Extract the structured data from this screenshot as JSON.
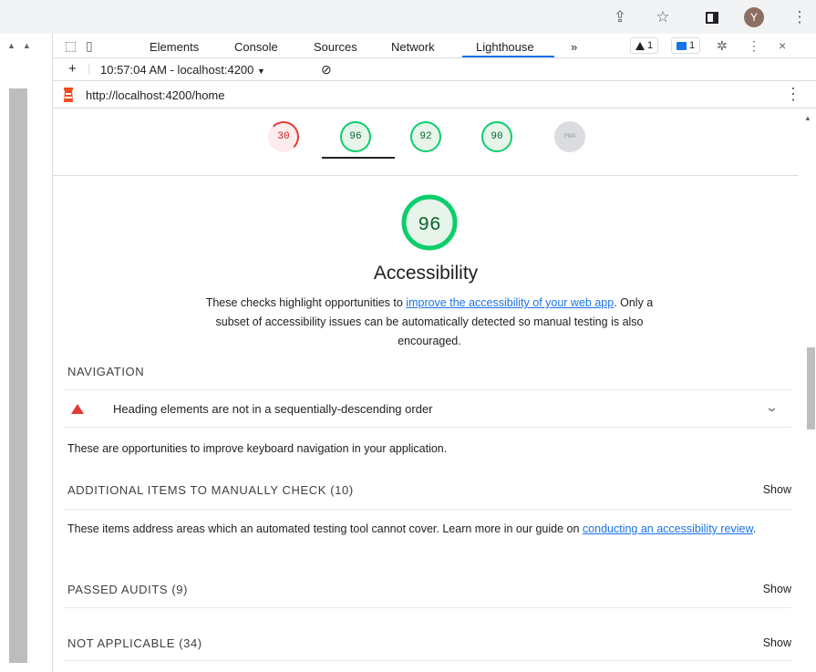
{
  "browser": {
    "avatar_letter": "Y",
    "icons": [
      "share-icon",
      "star-icon",
      "side-panel-icon",
      "more-vert-icon"
    ]
  },
  "devtools": {
    "tabs": [
      "Elements",
      "Console",
      "Sources",
      "Network",
      "Lighthouse"
    ],
    "more_tabs": "»",
    "warning_count": "1",
    "message_count": "1",
    "close": "×"
  },
  "report": {
    "selector": "10:57:04 AM - localhost:4200",
    "add": "+",
    "url": "http://localhost:4200/home"
  },
  "scores": [
    {
      "value": "30",
      "status": "fail"
    },
    {
      "value": "96",
      "status": "pass"
    },
    {
      "value": "92",
      "status": "pass"
    },
    {
      "value": "90",
      "status": "pass"
    },
    {
      "value": "PWA",
      "status": "na"
    }
  ],
  "category": {
    "score": "96",
    "title": "Accessibility",
    "desc_before": "These checks highlight opportunities to ",
    "desc_link": "improve the accessibility of your web app",
    "desc_after": ". Only a subset of accessibility issues can be automatically detected so manual testing is also encouraged."
  },
  "sections": {
    "navigation": "NAVIGATION",
    "audit_heading_order": "Heading elements are not in a sequentially-descending order",
    "navigation_desc": "These are opportunities to improve keyboard navigation in your application.",
    "manual": "ADDITIONAL ITEMS TO MANUALLY CHECK (10)",
    "manual_desc_before": "These items address areas which an automated testing tool cannot cover. Learn more in our guide on ",
    "manual_desc_link": "conducting an accessibility review",
    "manual_desc_after": ".",
    "passed": "PASSED AUDITS (9)",
    "not_applicable": "NOT APPLICABLE (34)",
    "show_label": "Show"
  }
}
